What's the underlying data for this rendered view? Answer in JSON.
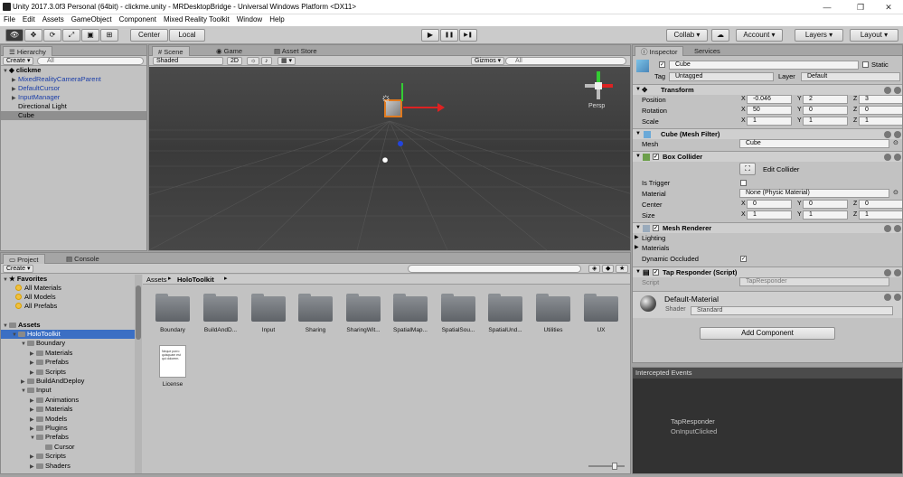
{
  "window": {
    "title": "Unity 2017.3.0f3 Personal (64bit) - clickme.unity - MRDesktopBridge - Universal Windows Platform <DX11>",
    "minimize": "—",
    "maximize": "❐",
    "close": "✕"
  },
  "menu": [
    "File",
    "Edit",
    "Assets",
    "GameObject",
    "Component",
    "Mixed Reality Toolkit",
    "Window",
    "Help"
  ],
  "toolbar": {
    "pivot": "Center",
    "space": "Local",
    "collab": "Collab ▾",
    "account": "Account ▾",
    "layers": "Layers ▾",
    "layout": "Layout ▾",
    "play": "▶",
    "pause": "❚❚",
    "step": "▶❚"
  },
  "hierarchy": {
    "tab": "Hierarchy",
    "create": "Create ▾",
    "search_placeholder": "All",
    "scene": "clickme",
    "items": [
      "MixedRealityCameraParent",
      "DefaultCursor",
      "InputManager",
      "Directional Light",
      "Cube"
    ]
  },
  "scene": {
    "tabs": [
      "Scene",
      "Game",
      "Asset Store"
    ],
    "shading": "Shaded",
    "mode2d": "2D",
    "gizmos": "Gizmos ▾",
    "search_placeholder": "All",
    "persp": "Persp"
  },
  "project": {
    "tabs": [
      "Project",
      "Console"
    ],
    "create": "Create ▾",
    "favorites_title": "Favorites",
    "favorites": [
      "All Materials",
      "All Models",
      "All Prefabs"
    ],
    "assets_title": "Assets",
    "tree": [
      {
        "label": "HoloToolkit",
        "indent": 1,
        "open": true,
        "selected": true
      },
      {
        "label": "Boundary",
        "indent": 2,
        "open": true
      },
      {
        "label": "Materials",
        "indent": 3
      },
      {
        "label": "Prefabs",
        "indent": 3
      },
      {
        "label": "Scripts",
        "indent": 3
      },
      {
        "label": "BuildAndDeploy",
        "indent": 2
      },
      {
        "label": "Input",
        "indent": 2,
        "open": true
      },
      {
        "label": "Animations",
        "indent": 3
      },
      {
        "label": "Materials",
        "indent": 3
      },
      {
        "label": "Models",
        "indent": 3
      },
      {
        "label": "Plugins",
        "indent": 3
      },
      {
        "label": "Prefabs",
        "indent": 3,
        "open": true
      },
      {
        "label": "Cursor",
        "indent": 4
      },
      {
        "label": "Scripts",
        "indent": 3
      },
      {
        "label": "Shaders",
        "indent": 3
      }
    ],
    "breadcrumb": [
      "Assets",
      "HoloToolkit"
    ],
    "folders": [
      "Boundary",
      "BuildAndD...",
      "Input",
      "Sharing",
      "SharingWit...",
      "SpatialMap...",
      "SpatialSou...",
      "SpatialUnd...",
      "Utilities",
      "UX"
    ],
    "file": "License",
    "file_preview": "Neque porro quisquam est qui dolorem."
  },
  "inspector": {
    "tabs": [
      "Inspector",
      "Services"
    ],
    "object_name": "Cube",
    "static_label": "Static",
    "tag_label": "Tag",
    "tag_value": "Untagged",
    "layer_label": "Layer",
    "layer_value": "Default",
    "transform": {
      "title": "Transform",
      "position_label": "Position",
      "position": [
        "-0.046",
        "2",
        "3"
      ],
      "rotation_label": "Rotation",
      "rotation": [
        "50",
        "0",
        "0"
      ],
      "scale_label": "Scale",
      "scale": [
        "1",
        "1",
        "1"
      ]
    },
    "mesh_filter": {
      "title": "Cube (Mesh Filter)",
      "mesh_label": "Mesh",
      "mesh_value": "Cube"
    },
    "box_collider": {
      "title": "Box Collider",
      "edit_label": "Edit Collider",
      "trigger_label": "Is Trigger",
      "material_label": "Material",
      "material_value": "None (Physic Material)",
      "center_label": "Center",
      "center": [
        "0",
        "0",
        "0"
      ],
      "size_label": "Size",
      "size": [
        "1",
        "1",
        "1"
      ]
    },
    "mesh_renderer": {
      "title": "Mesh Renderer",
      "lighting": "Lighting",
      "materials": "Materials",
      "occluded_label": "Dynamic Occluded"
    },
    "tap_responder": {
      "title": "Tap Responder (Script)",
      "script_label": "Script",
      "script_value": "TapResponder"
    },
    "material": {
      "name": "Default-Material",
      "shader_label": "Shader",
      "shader_value": "Standard"
    },
    "add_component": "Add Component",
    "axes": [
      "X",
      "Y",
      "Z"
    ]
  },
  "events": {
    "title": "Intercepted Events",
    "line1": "TapResponder",
    "line2": "OnInputClicked"
  }
}
